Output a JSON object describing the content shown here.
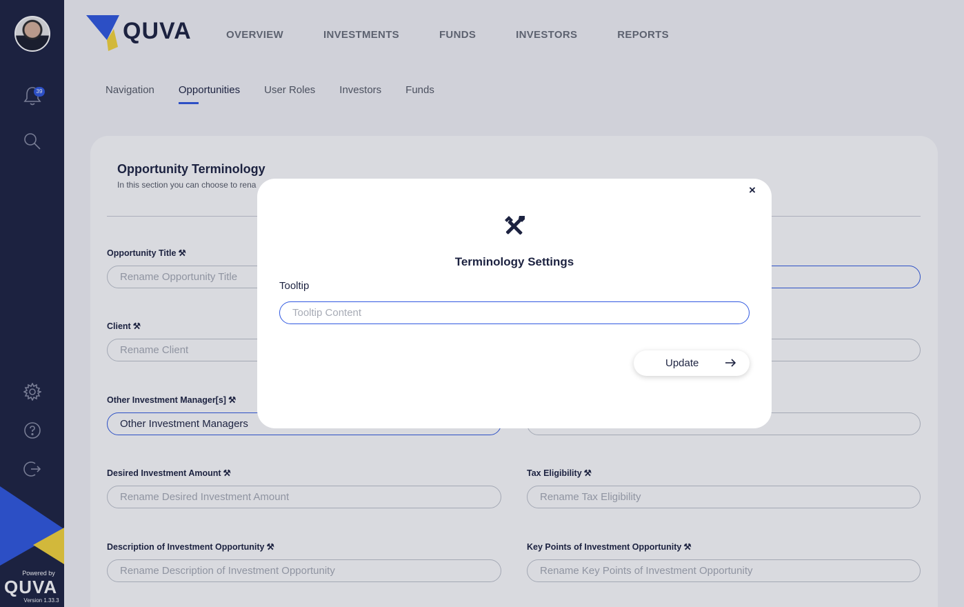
{
  "brand": {
    "name": "QUVA",
    "powered_by": "Powered by",
    "version": "Version 1.33.3",
    "colors": {
      "navy": "#1c2240",
      "blue": "#2f58e0",
      "yellow": "#f7d63a"
    }
  },
  "sidebar": {
    "notification_count": "39",
    "icons": [
      "avatar",
      "bell-icon",
      "search-icon",
      "gear-icon",
      "help-icon",
      "logout-icon"
    ]
  },
  "topnav": {
    "items": [
      "OVERVIEW",
      "INVESTMENTS",
      "FUNDS",
      "INVESTORS",
      "REPORTS"
    ]
  },
  "subnav": {
    "items": [
      "Navigation",
      "Opportunities",
      "User Roles",
      "Investors",
      "Funds"
    ],
    "active": "Opportunities"
  },
  "section": {
    "title": "Opportunity Terminology",
    "subtitle": "In this section you can choose to rena"
  },
  "fields": {
    "opportunity_title": {
      "label": "Opportunity Title",
      "placeholder": "Rename Opportunity Title"
    },
    "client": {
      "label": "Client",
      "placeholder": "Rename Client"
    },
    "other_managers": {
      "label": "Other Investment Manager[s]",
      "value": "Other Investment Managers"
    },
    "desired_amount": {
      "label": "Desired Investment Amount",
      "placeholder": "Rename Desired Investment Amount"
    },
    "tax_eligibility": {
      "label": "Tax Eligibility",
      "placeholder": "Rename Tax Eligibility"
    },
    "description": {
      "label": "Description of Investment Opportunity",
      "placeholder": "Rename Description of Investment Opportunity"
    },
    "key_points": {
      "label": "Key Points of Investment Opportunity",
      "placeholder": "Rename Key Points of Investment Opportunity"
    }
  },
  "modal": {
    "title": "Terminology Settings",
    "close": "×",
    "tooltip_label": "Tooltip",
    "tooltip_placeholder": "Tooltip Content",
    "update_label": "Update"
  }
}
